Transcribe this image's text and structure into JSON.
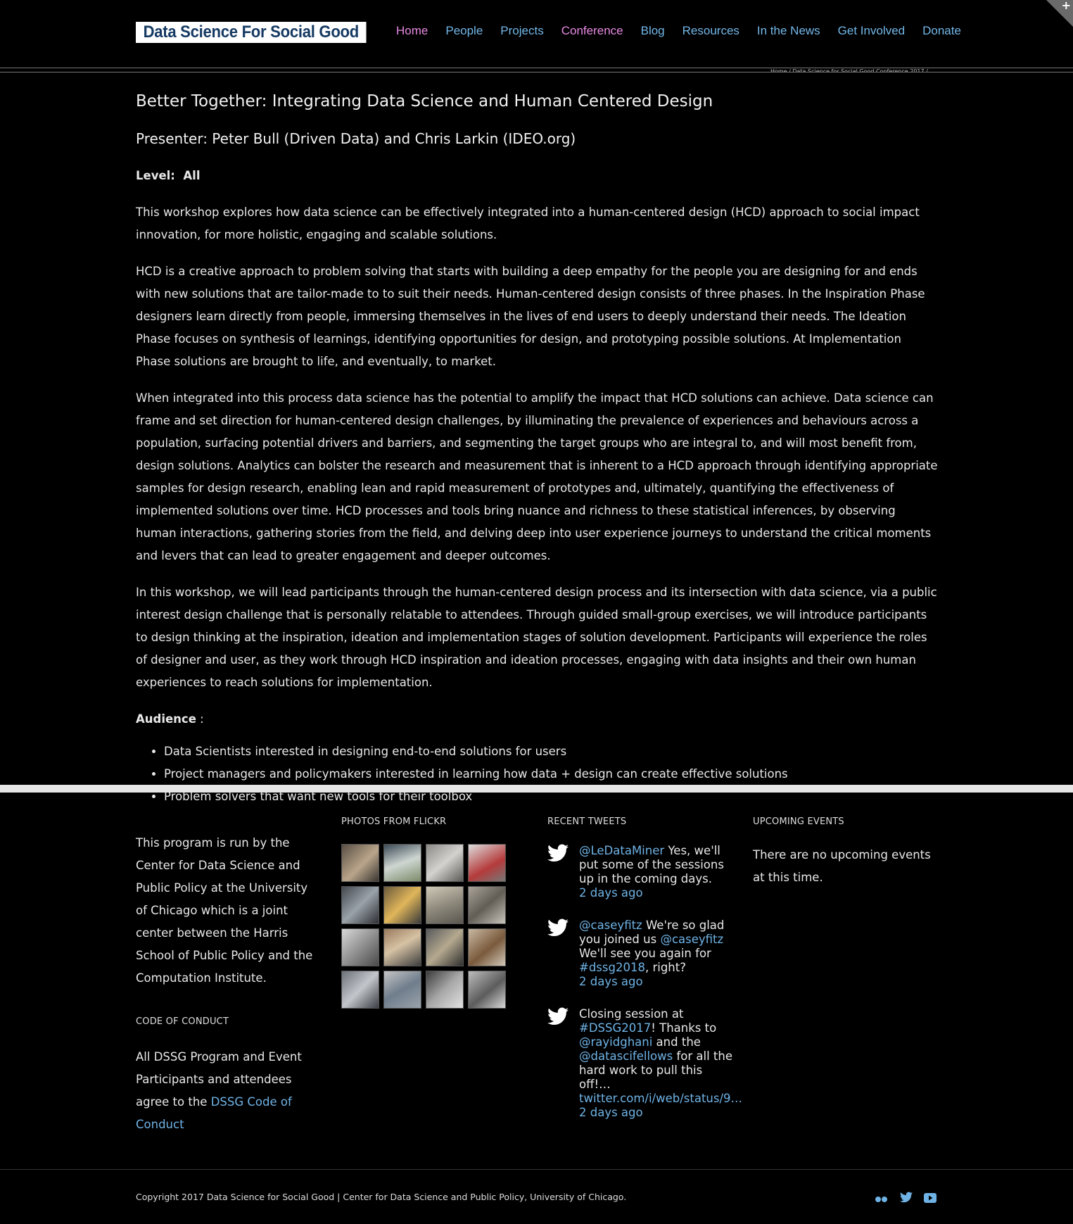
{
  "header": {
    "logo_text": "Data Science For Social Good",
    "nav": [
      "Home",
      "People",
      "Projects",
      "Conference",
      "Blog",
      "Resources",
      "In the News",
      "Get Involved",
      "Donate"
    ],
    "breadcrumb": "Home / Data Science for Social Good Conference 2017 / ..."
  },
  "main": {
    "title": "Better Together: Integrating Data Science and Human Centered Design",
    "presenter": "Presenter: Peter Bull (Driven Data) and Chris Larkin (IDEO.org)",
    "level_label": "Level:",
    "level_value": "All",
    "paragraphs": [
      "This workshop explores how data science can be effectively integrated into a human-centered design (HCD) approach to social impact innovation, for more holistic, engaging and scalable solutions.",
      "HCD is a creative approach to problem solving that starts with building a deep empathy for the people you are designing for and ends with new solutions that are tailor-made to to suit their needs. Human-centered design consists of three phases. In the Inspiration Phase designers learn directly from people, immersing themselves in the lives of end users to deeply understand their needs. The Ideation Phase focuses on synthesis of learnings, identifying opportunities for design, and prototyping possible solutions. At Implementation Phase solutions are brought to life, and eventually, to market.",
      "When integrated into this process data science has the potential to amplify the impact that HCD solutions can achieve. Data science can frame and set direction for human-centered design challenges, by illuminating the prevalence of experiences and behaviours across a population, surfacing potential drivers and barriers, and segmenting the target groups who are integral to, and will most benefit from, design solutions. Analytics can bolster the research and measurement that is inherent to a HCD approach through identifying appropriate samples for design research, enabling lean and rapid measurement of prototypes and, ultimately, quantifying the effectiveness of implemented solutions over time. HCD processes and tools bring nuance and richness to these statistical inferences, by observing human interactions, gathering stories from the field, and delving deep into user experience journeys to understand the critical moments and levers that can lead to greater engagement and deeper outcomes.",
      "In this workshop, we will lead participants through the human-centered design process and its intersection with data science, via a public interest design challenge that is personally relatable to attendees. Through guided small-group exercises, we will introduce participants to design thinking at the inspiration, ideation and implementation stages of solution development. Participants will experience the roles of designer and user, as they work through HCD inspiration and ideation processes, engaging with data insights and their own human experiences to reach solutions for implementation."
    ],
    "audience_label": "Audience",
    "audience_colon": " :",
    "audience": [
      "Data Scientists interested in designing end-to-end solutions for users",
      "Project managers and policymakers interested in learning how data + design can create effective solutions",
      "Problem solvers that want new tools for their toolbox"
    ]
  },
  "footer": {
    "about": "This program is run by the Center for Data Science and Public Policy at the University of Chicago which is a joint center between the Harris School of Public Policy and the Computation Institute.",
    "coc_heading": "CODE OF CONDUCT",
    "coc_text": "All DSSG Program and Event Participants and attendees agree to the ",
    "coc_link": "DSSG Code of Conduct",
    "flickr_heading": "PHOTOS FROM FLICKR",
    "tweets_heading": "RECENT TWEETS",
    "tweets": [
      {
        "parts": [
          {
            "t": "@LeDataMiner",
            "link": true
          },
          {
            "t": " Yes, we'll put some of the sessions up in the coming days.",
            "link": false
          }
        ],
        "time": "2 days ago"
      },
      {
        "parts": [
          {
            "t": "@caseyfitz",
            "link": true
          },
          {
            "t": " We're so glad you joined us ",
            "link": false
          },
          {
            "t": "@caseyfitz",
            "link": true
          },
          {
            "t": " We'll see you again for ",
            "link": false
          },
          {
            "t": "#dssg2018",
            "link": true
          },
          {
            "t": ", right?",
            "link": false
          }
        ],
        "time": "2 days ago"
      },
      {
        "parts": [
          {
            "t": "Closing session at ",
            "link": false
          },
          {
            "t": "#DSSG2017",
            "link": true
          },
          {
            "t": "! Thanks to ",
            "link": false
          },
          {
            "t": "@rayidghani",
            "link": true
          },
          {
            "t": " and the ",
            "link": false
          },
          {
            "t": "@datascifellows",
            "link": true
          },
          {
            "t": " for all the hard work to pull this off!… ",
            "link": false
          },
          {
            "t": "twitter.com/i/web/status/9…",
            "link": true
          }
        ],
        "time": "2 days ago"
      }
    ],
    "events_heading": "UPCOMING EVENTS",
    "events_text": "There are no upcoming events at this time.",
    "copyright": "Copyright 2017 Data Science for Social Good | Center for Data Science and Public Policy, University of Chicago.",
    "social_icons": [
      "flickr-icon",
      "twitter-icon",
      "youtube-icon"
    ]
  },
  "colors": {
    "background": "#000000",
    "link": "#6fb3e6",
    "nav_active": "#e88ae3",
    "logo_text": "#163a63",
    "band": "#e6e6e6"
  }
}
